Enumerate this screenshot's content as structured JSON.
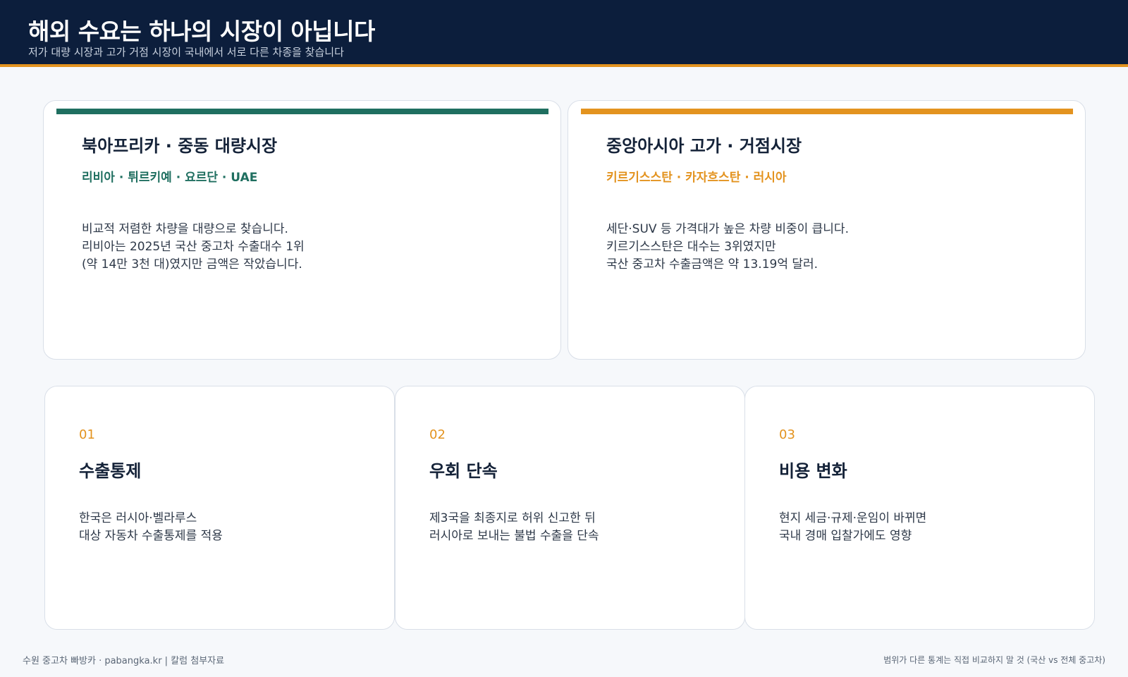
{
  "header": {
    "title": "해외 수요는 하나의 시장이 아닙니다",
    "subtitle": "저가 대량 시장과 고가 거점 시장이 국내에서 서로 다른 차종을 찾습니다"
  },
  "markets": [
    {
      "title": "북아프리카 · 중동 대량시장",
      "regions": "리비아 · 튀르키예 · 요르단 · UAE",
      "lines": [
        "비교적 저렴한 차량을 대량으로 찾습니다.",
        "리비아는 2025년 국산 중고차 수출대수 1위",
        "(약 14만 3천 대)였지만 금액은 작았습니다."
      ],
      "accent": "#1f6f60"
    },
    {
      "title": "중앙아시아 고가 · 거점시장",
      "regions": "키르기스스탄 · 카자흐스탄 · 러시아",
      "lines": [
        "세단·SUV 등 가격대가 높은 차량 비중이 큽니다.",
        "키르기스스탄은 대수는 3위였지만",
        "국산 중고차 수출금액은 약 13.19억 달러."
      ],
      "accent": "#e3931f"
    }
  ],
  "issues": [
    {
      "num": "01",
      "title": "수출통제",
      "lines": [
        "한국은 러시아·벨라루스",
        "대상 자동차 수출통제를 적용"
      ]
    },
    {
      "num": "02",
      "title": "우회 단속",
      "lines": [
        "제3국을 최종지로 허위 신고한 뒤",
        "러시아로 보내는 불법 수출을 단속"
      ]
    },
    {
      "num": "03",
      "title": "비용 변화",
      "lines": [
        "현지 세금·규제·운임이 바뀌면",
        "국내 경매 입찰가에도 영향"
      ]
    }
  ],
  "footer": {
    "left": "수원 중고차 빠방카  ·  pabangka.kr   |   칼럼 첨부자료",
    "right": "범위가 다른 통계는 직접 비교하지 말 것 (국산 vs 전체 중고차)"
  },
  "colors": {
    "header_bg": "#0c1e3c",
    "accent_orange": "#e3931f",
    "accent_green": "#1f6f60"
  }
}
